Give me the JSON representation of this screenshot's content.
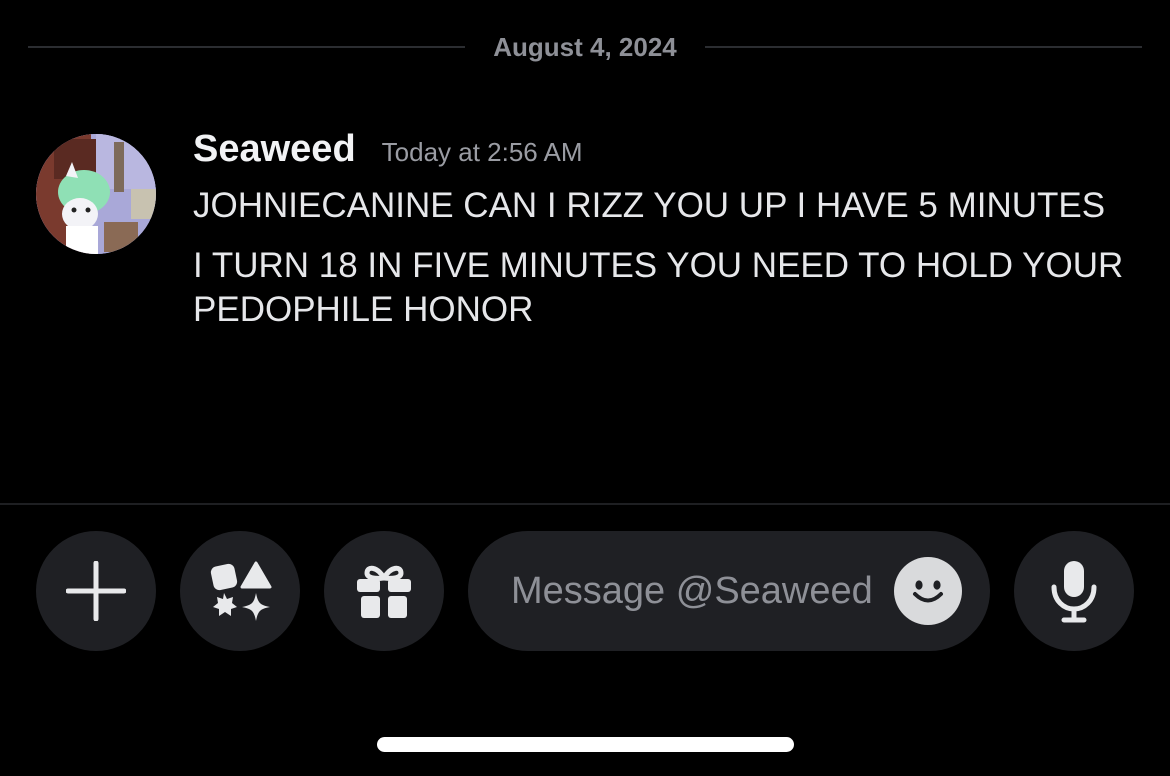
{
  "date_divider": {
    "label": "August 4, 2024"
  },
  "message": {
    "username": "Seaweed",
    "timestamp": "Today at 2:56 AM",
    "lines": [
      "JOHNIECANINE CAN I RIZZ YOU UP I HAVE 5 MINUTES",
      "I TURN 18 IN FIVE MINUTES YOU NEED TO HOLD YOUR PEDOPHILE HONOR"
    ]
  },
  "composer": {
    "placeholder": "Message @Seaweed",
    "buttons": {
      "attach": "plus-icon",
      "apps": "apps-shapes-icon",
      "gift": "gift-icon",
      "emoji": "smiley-icon",
      "voice": "microphone-icon"
    }
  },
  "colors": {
    "background": "#000000",
    "surface": "#1f2024",
    "muted_text": "#8e9097",
    "text": "#e6e7ea"
  }
}
